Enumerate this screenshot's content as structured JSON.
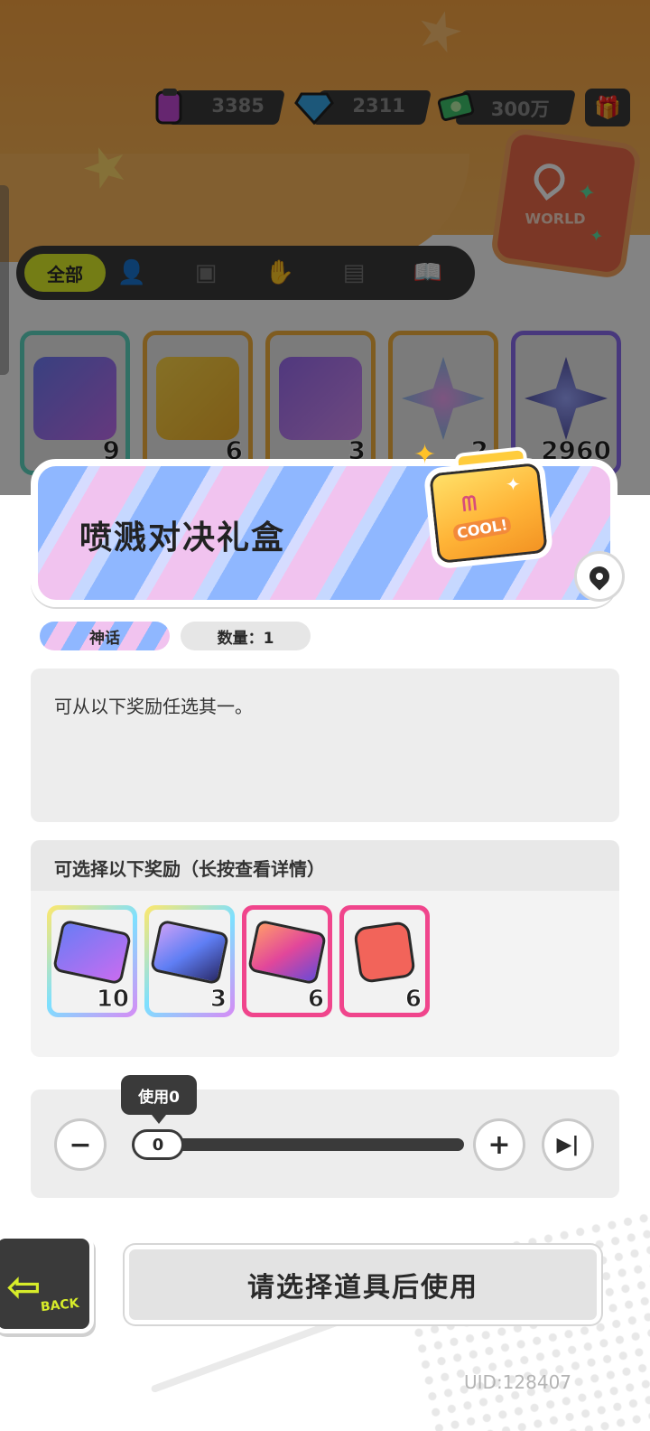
{
  "currencies": [
    {
      "name": "ticket-currency",
      "value": "3385"
    },
    {
      "name": "diamond-currency",
      "value": "2311"
    },
    {
      "name": "cash-currency",
      "value": "300万"
    }
  ],
  "tabs": {
    "active_label": "全部",
    "icons": [
      "person-icon",
      "box-icon",
      "hand-icon",
      "card-icon",
      "book-icon"
    ]
  },
  "inventory": [
    {
      "count": "9",
      "color": "#5fd6c2"
    },
    {
      "count": "6",
      "color": "#f3b03f"
    },
    {
      "count": "3",
      "color": "#f3b03f"
    },
    {
      "count": "2",
      "color": "#f3b03f"
    },
    {
      "count": "2960",
      "color": "#8a6cf0"
    }
  ],
  "item": {
    "title": "喷溅对决礼盒",
    "rarity": "神话",
    "quantity": "数量：1",
    "description": "可从以下奖励任选其一。",
    "box_label": "COOL!"
  },
  "rewards": {
    "header": "可选择以下奖励（长按查看详情）",
    "items": [
      {
        "count": "10",
        "frame": "rainbow"
      },
      {
        "count": "3",
        "frame": "rainbow"
      },
      {
        "count": "6",
        "frame": "pink"
      },
      {
        "count": "6",
        "frame": "pink"
      }
    ]
  },
  "usage": {
    "tooltip": "使用0",
    "value": "0",
    "fraction": 0
  },
  "buttons": {
    "back_label": "BACK",
    "use_label": "请选择道具后使用"
  },
  "uid": "UID:128407",
  "world_label": "WORLD"
}
